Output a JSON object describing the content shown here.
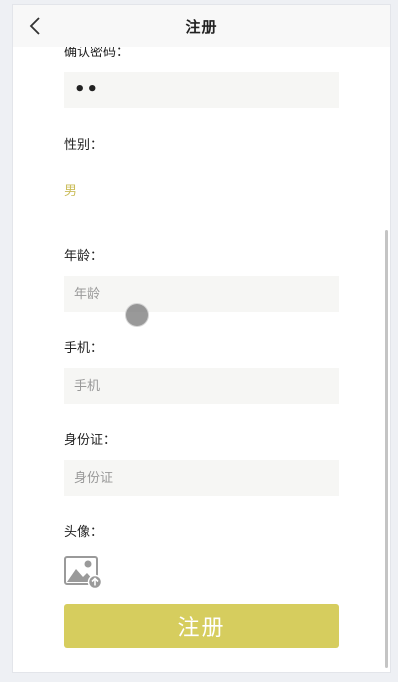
{
  "nav": {
    "title": "注册",
    "back_icon": "chevron-left-icon"
  },
  "form": {
    "confirm_password_label": "确认密码：",
    "confirm_password_value": "••",
    "gender_label": "性别：",
    "gender_value": "男",
    "age_label": "年龄：",
    "age_placeholder": "年龄",
    "phone_label": "手机：",
    "phone_placeholder": "手机",
    "id_label": "身份证：",
    "id_placeholder": "身份证",
    "avatar_label": "头像：",
    "avatar_icon": "image-upload-icon",
    "submit_label": "注册"
  },
  "colors": {
    "accent": "#d6cd5e",
    "gender_text": "#cbbd5b",
    "field_bg": "#f6f6f4"
  }
}
